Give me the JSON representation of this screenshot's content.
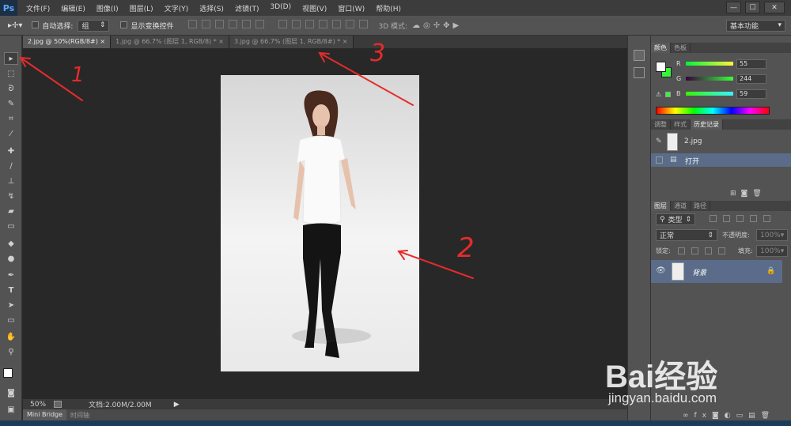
{
  "app": {
    "logo": "Ps"
  },
  "menu": [
    "文件(F)",
    "编辑(E)",
    "图像(I)",
    "图层(L)",
    "文字(Y)",
    "选择(S)",
    "滤镜(T)",
    "3D(D)",
    "视图(V)",
    "窗口(W)",
    "帮助(H)"
  ],
  "window_buttons": [
    "—",
    "☐",
    "✕"
  ],
  "options": {
    "auto_select_label": "自动选择:",
    "auto_select_value": "组",
    "show_transform_label": "显示变换控件",
    "mode3d_label": "3D 模式:",
    "workspace": "基本功能"
  },
  "tabs": [
    {
      "label": "2.jpg @ 50%(RGB/8#)",
      "close": "×",
      "active": true
    },
    {
      "label": "1.jpg @ 66.7% (图层 1, RGB/8) *",
      "close": "×",
      "active": false
    },
    {
      "label": "3.jpg @ 66.7% (图层 1, RGB/8#) *",
      "close": "×",
      "active": false
    }
  ],
  "status": {
    "zoom": "50%",
    "doc": "文档:2.00M/2.00M"
  },
  "bottom_tabs": [
    "Mini Bridge",
    "时间轴"
  ],
  "color_panel": {
    "tabs": [
      "颜色",
      "色板"
    ],
    "channels": [
      {
        "name": "R",
        "value": "55"
      },
      {
        "name": "G",
        "value": "244"
      },
      {
        "name": "B",
        "value": "59"
      }
    ],
    "foreground": "#37f43b"
  },
  "history_panel": {
    "tabs": [
      "调整",
      "样式",
      "历史记录"
    ],
    "snapshot": "2.jpg",
    "items": [
      "打开"
    ]
  },
  "layers_panel": {
    "tabs": [
      "图层",
      "通道",
      "路径"
    ],
    "filter_label": "类型",
    "blend_mode": "正常",
    "opacity_label": "不透明度:",
    "opacity_value": "100%",
    "lock_label": "锁定:",
    "fill_label": "填充:",
    "fill_value": "100%",
    "layer_name": "背景"
  },
  "annotations": [
    "1",
    "2",
    "3"
  ],
  "watermark": {
    "brand": "Bai经验",
    "url": "jingyan.baidu.com"
  }
}
